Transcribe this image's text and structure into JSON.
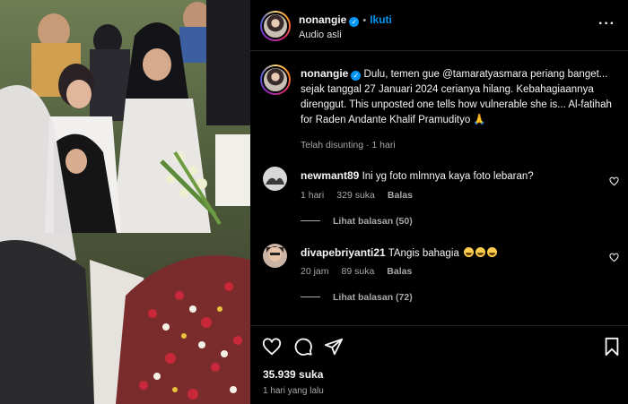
{
  "post": {
    "username": "nonangie",
    "follow_label": "Ikuti",
    "audio": "Audio asli",
    "more_icon": "more-options-icon"
  },
  "caption": {
    "username": "nonangie",
    "text": "Dulu, temen gue @tamaratyasmara periang banget... sejak tanggal 27 Januari 2024 cerianya hilang. Kebahagiaannya direnggut. This unposted one tells how vulnerable she is... Al-fatihah for Raden Andante Khalif Pramudityo 🙏",
    "meta": "Telah disunting · 1 hari"
  },
  "comments": [
    {
      "username": "newmant89",
      "text": "Ini yg foto mlmnya kaya foto lebaran?",
      "time": "1 hari",
      "likes": "329 suka",
      "reply_label": "Balas",
      "view_replies": "Lihat balasan (50)"
    },
    {
      "username": "divapebriyanti21",
      "text": "TAngis bahagia",
      "emoji_count": 3,
      "time": "20 jam",
      "likes": "89 suka",
      "reply_label": "Balas",
      "view_replies": "Lihat balasan (72)"
    }
  ],
  "actions": {
    "likes": "35.939 suka",
    "time_ago": "1 hari yang lalu"
  },
  "colors": {
    "accent": "#0095f6",
    "background": "#000000",
    "muted_text": "#a8a8a8"
  }
}
